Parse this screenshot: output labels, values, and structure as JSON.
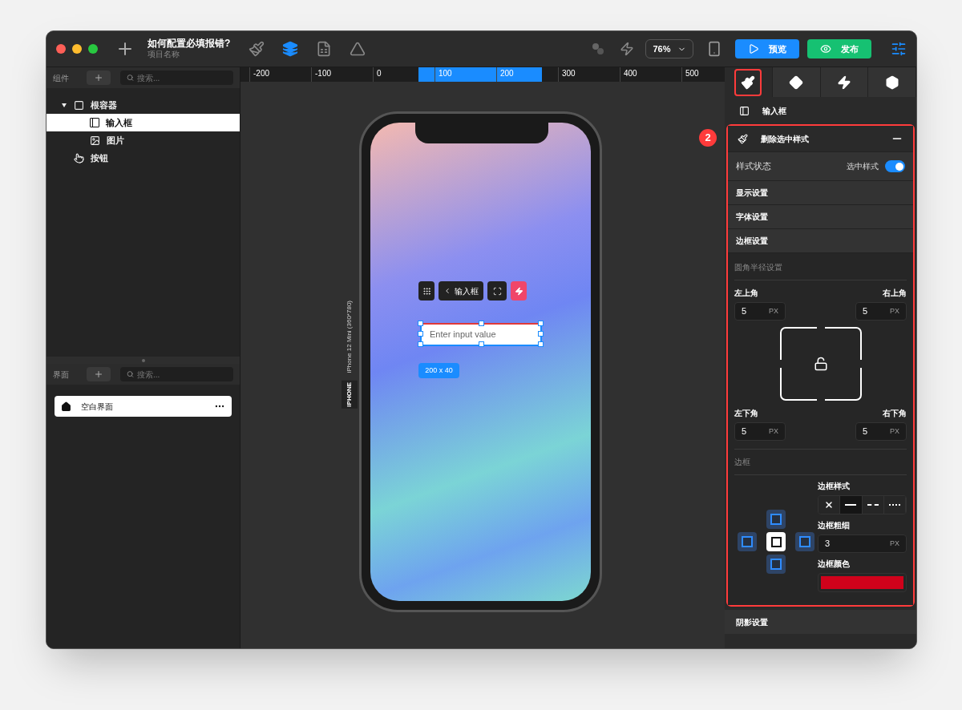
{
  "window": {
    "title": "如何配置必填报错?",
    "subtitle": "项目名称"
  },
  "toolbar": {
    "tools": [
      {
        "kind": "brush",
        "selected": false
      },
      {
        "kind": "layers",
        "selected": true
      },
      {
        "kind": "sheet",
        "selected": false
      },
      {
        "kind": "drive",
        "selected": false
      }
    ],
    "zoom": "76%",
    "preview_button": "预览",
    "publish_button": "发布"
  },
  "ruler": {
    "ticks": [
      "-200",
      "-100",
      "0",
      "100",
      "200",
      "300",
      "400",
      "500"
    ]
  },
  "components_panel": {
    "label": "组件",
    "search": {
      "placeholder": "搜索..."
    },
    "tree": [
      {
        "label": "根容器",
        "kind": "container",
        "selected": false,
        "expanded": true,
        "children": [
          {
            "label": "输入框",
            "kind": "input",
            "selected": true
          },
          {
            "label": "图片",
            "kind": "image",
            "selected": false
          }
        ]
      },
      {
        "label": "按钮",
        "kind": "button",
        "selected": false
      }
    ]
  },
  "pages_panel": {
    "label": "界面",
    "search": {
      "placeholder": "搜索..."
    },
    "pages": [
      {
        "label": "空白界面",
        "selected": true
      }
    ]
  },
  "canvas": {
    "device_label": "iPhone 12 Mini (360*780)",
    "device_tag": "IPHONE",
    "breadcrumb": "输入框",
    "input": {
      "placeholder": "Enter input value"
    },
    "size_badge": "200 x 40"
  },
  "inspector": {
    "tabs": [
      {
        "kind": "style",
        "selected": true
      },
      {
        "kind": "layout",
        "selected": false
      },
      {
        "kind": "action",
        "selected": false
      },
      {
        "kind": "component",
        "selected": false
      }
    ],
    "element": "输入框",
    "annotation": "2",
    "section_header": "删除选中样式",
    "style_state": {
      "label": "样式状态",
      "toggle_label": "选中样式",
      "on": true
    },
    "sections": [
      "显示设置",
      "字体设置",
      "边框设置"
    ],
    "radius": {
      "title": "圆角半径设置",
      "corners": [
        {
          "label": "左上角",
          "value": "5",
          "unit": "PX"
        },
        {
          "label": "右上角",
          "value": "5",
          "unit": "PX"
        },
        {
          "label": "左下角",
          "value": "5",
          "unit": "PX"
        },
        {
          "label": "右下角",
          "value": "5",
          "unit": "PX"
        }
      ]
    },
    "border": {
      "title": "边框",
      "style_label": "边框样式",
      "styles": [
        {
          "kind": "none",
          "selected": false
        },
        {
          "kind": "solid",
          "selected": true
        },
        {
          "kind": "dashed",
          "selected": false
        },
        {
          "kind": "dotted",
          "selected": false
        }
      ],
      "width_label": "边框粗细",
      "width": {
        "value": "3",
        "unit": "PX"
      },
      "color_label": "边框颜色",
      "color": "#d0021b"
    },
    "shadow_section": "阴影设置"
  }
}
